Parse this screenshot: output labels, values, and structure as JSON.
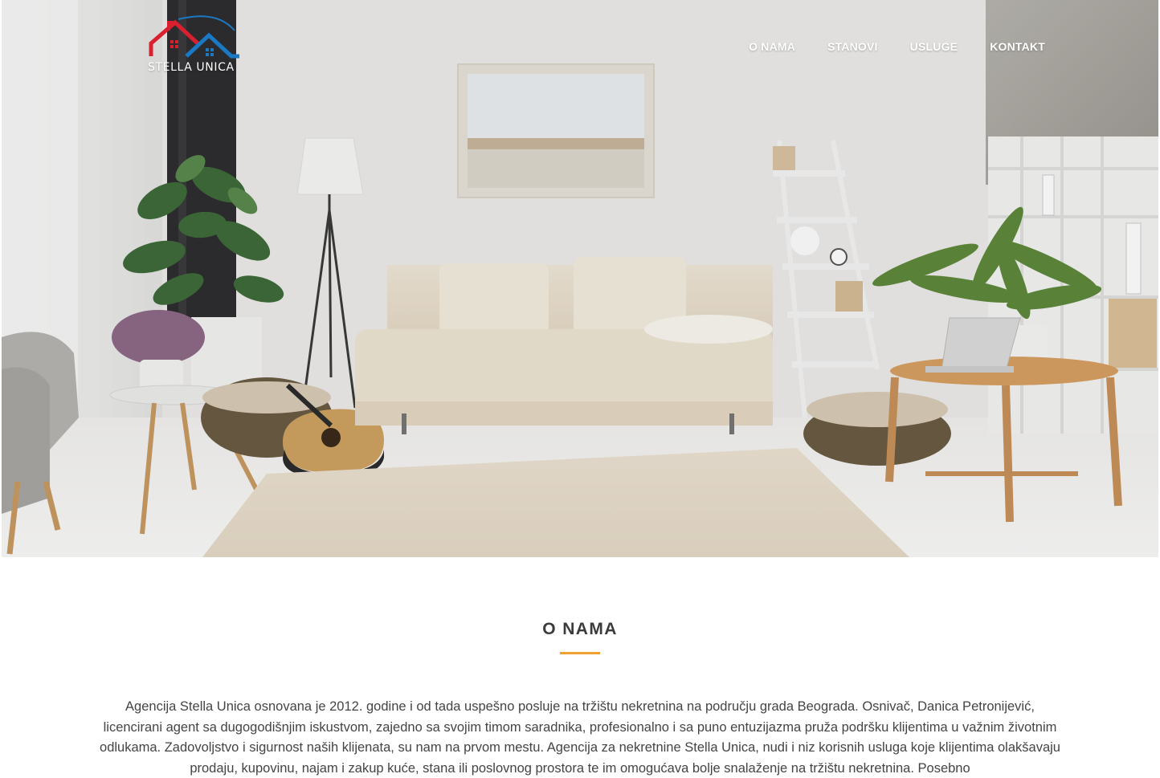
{
  "brand": {
    "name": "STELLA UNICA",
    "colors": {
      "roof_left": "#d8202e",
      "roof_right": "#1b79c4",
      "accent": "#f0a030"
    }
  },
  "nav": {
    "items": [
      {
        "label": "O NAMA"
      },
      {
        "label": "STANOVI"
      },
      {
        "label": "USLUGE"
      },
      {
        "label": "KONTAKT"
      }
    ]
  },
  "about": {
    "title": "O NAMA",
    "text": "Agencija Stella Unica osnovana je 2012. godine i od tada uspešno posluje na tržištu nekretnina na području grada Beograda. Osnivač, Danica Petronijević, licencirani agent sa dugogodišnjim iskustvom, zajedno sa svojim timom saradnika, profesionalno i sa puno entuzijazma pruža podršku klijentima u važnim životnim odlukama. Zadovoljstvo i sigurnost naših klijenata, su nam na prvom mestu. Agencija za nekretnine Stella Unica, nudi i niz korisnih usluga koje klijentima olakšavaju prodaju, kupovinu, najam i zakup kuće, stana ili poslovnog prostora te im omogućava bolje snalaženje na tržištu nekretnina. Posebno"
  }
}
